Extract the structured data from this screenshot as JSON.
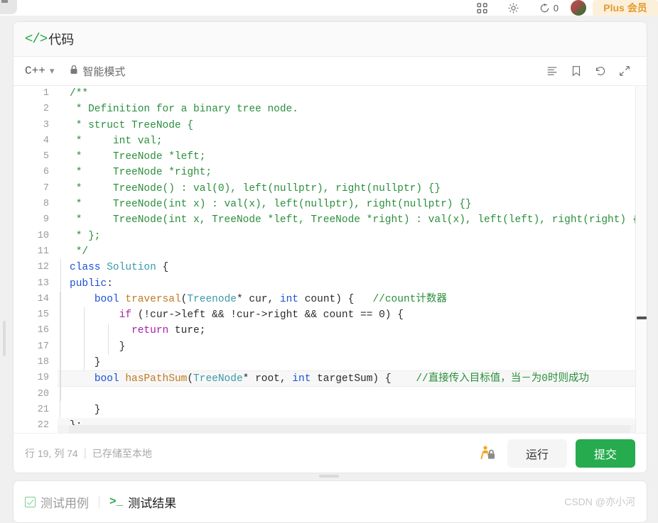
{
  "topbar": {
    "icons": [
      "apps-grid-icon",
      "gear-icon",
      "refresh-icon",
      "avatar"
    ],
    "notification_count": "0",
    "plus_label": "Plus 会员"
  },
  "code_panel": {
    "title": "代码",
    "title_icon": "code-brackets-icon",
    "toolbar": {
      "language": "C++",
      "language_chevron": "chevron-down-icon",
      "lock_icon": "lock-icon",
      "mode_label": "智能模式",
      "actions": [
        {
          "name": "format-code-icon",
          "label": "格式化"
        },
        {
          "name": "bookmark-icon",
          "label": "收藏"
        },
        {
          "name": "reset-code-icon",
          "label": "重置"
        },
        {
          "name": "fullscreen-icon",
          "label": "全屏"
        }
      ]
    },
    "editor": {
      "current_line": 19,
      "lines": [
        {
          "n": "1",
          "tokens": [
            {
              "t": "/**",
              "c": "cmt"
            }
          ]
        },
        {
          "n": "2",
          "tokens": [
            {
              "t": " * Definition for a binary tree node.",
              "c": "cmt"
            }
          ]
        },
        {
          "n": "3",
          "tokens": [
            {
              "t": " * struct TreeNode {",
              "c": "cmt"
            }
          ]
        },
        {
          "n": "4",
          "tokens": [
            {
              "t": " *     int val;",
              "c": "cmt"
            }
          ]
        },
        {
          "n": "5",
          "tokens": [
            {
              "t": " *     TreeNode *left;",
              "c": "cmt"
            }
          ]
        },
        {
          "n": "6",
          "tokens": [
            {
              "t": " *     TreeNode *right;",
              "c": "cmt"
            }
          ]
        },
        {
          "n": "7",
          "tokens": [
            {
              "t": " *     TreeNode() : val(0), left(nullptr), right(nullptr) {}",
              "c": "cmt"
            }
          ]
        },
        {
          "n": "8",
          "tokens": [
            {
              "t": " *     TreeNode(int x) : val(x), left(nullptr), right(nullptr) {}",
              "c": "cmt"
            }
          ]
        },
        {
          "n": "9",
          "tokens": [
            {
              "t": " *     TreeNode(int x, TreeNode *left, TreeNode *right) : val(x), left(left), right(right) {}",
              "c": "cmt"
            }
          ]
        },
        {
          "n": "10",
          "tokens": [
            {
              "t": " * };",
              "c": "cmt"
            }
          ]
        },
        {
          "n": "11",
          "tokens": [
            {
              "t": " */",
              "c": "cmt"
            }
          ]
        },
        {
          "n": "12",
          "tokens": [
            {
              "t": "class",
              "c": "kw"
            },
            {
              "t": " ",
              "c": "pln"
            },
            {
              "t": "Solution",
              "c": "typ"
            },
            {
              "t": " {",
              "c": "pln"
            }
          ]
        },
        {
          "n": "13",
          "tokens": [
            {
              "t": "public",
              "c": "kw"
            },
            {
              "t": ":",
              "c": "pln"
            }
          ]
        },
        {
          "n": "14",
          "tokens": [
            {
              "t": "    ",
              "c": "pln"
            },
            {
              "t": "bool",
              "c": "kw"
            },
            {
              "t": " ",
              "c": "pln"
            },
            {
              "t": "traversal",
              "c": "fn"
            },
            {
              "t": "(",
              "c": "pln"
            },
            {
              "t": "Treenode",
              "c": "typ"
            },
            {
              "t": "* cur, ",
              "c": "pln"
            },
            {
              "t": "int",
              "c": "kw"
            },
            {
              "t": " count) {   ",
              "c": "pln"
            },
            {
              "t": "//count计数器",
              "c": "cmt"
            }
          ]
        },
        {
          "n": "15",
          "tokens": [
            {
              "t": "        ",
              "c": "pln"
            },
            {
              "t": "if",
              "c": "kw2"
            },
            {
              "t": " (!cur->left && !cur->right && count == ",
              "c": "pln"
            },
            {
              "t": "0",
              "c": "num"
            },
            {
              "t": ") {",
              "c": "pln"
            }
          ]
        },
        {
          "n": "16",
          "tokens": [
            {
              "t": "          ",
              "c": "pln"
            },
            {
              "t": "return",
              "c": "kw2"
            },
            {
              "t": " ture;",
              "c": "pln"
            }
          ]
        },
        {
          "n": "17",
          "tokens": [
            {
              "t": "        }",
              "c": "pln"
            }
          ]
        },
        {
          "n": "18",
          "tokens": [
            {
              "t": "    }",
              "c": "pln"
            }
          ]
        },
        {
          "n": "19",
          "tokens": [
            {
              "t": "    ",
              "c": "pln"
            },
            {
              "t": "bool",
              "c": "kw"
            },
            {
              "t": " ",
              "c": "pln"
            },
            {
              "t": "hasPathSum",
              "c": "fn"
            },
            {
              "t": "(",
              "c": "pln"
            },
            {
              "t": "TreeNode",
              "c": "typ"
            },
            {
              "t": "* root, ",
              "c": "pln"
            },
            {
              "t": "int",
              "c": "kw"
            },
            {
              "t": " targetSum) {    ",
              "c": "pln"
            },
            {
              "t": "//直接传入目标值，当－为0时则成功",
              "c": "cmt"
            }
          ]
        },
        {
          "n": "20",
          "tokens": [
            {
              "t": "",
              "c": "pln"
            }
          ]
        },
        {
          "n": "21",
          "tokens": [
            {
              "t": "    }",
              "c": "pln"
            }
          ]
        },
        {
          "n": "22",
          "tokens": [
            {
              "t": "};",
              "c": "pln"
            }
          ]
        }
      ]
    },
    "status": {
      "position": "行 19, 列 74",
      "separator": "|",
      "saved": "已存储至本地",
      "privacy_icon": "person-lock-icon",
      "run_label": "运行",
      "submit_label": "提交"
    }
  },
  "result_panel": {
    "tabs": [
      {
        "label": "测试用例",
        "icon": "checkbox-icon",
        "active": false
      },
      {
        "label": "测试结果",
        "icon": "terminal-icon",
        "active": true
      }
    ],
    "watermark": "CSDN @亦小河"
  },
  "colors": {
    "accent_green": "#26ac4e",
    "comment": "#2a8f3c",
    "keyword": "#1b50d8",
    "keyword_control": "#a81fa8",
    "function": "#c07a20",
    "type": "#3a9ba8",
    "plus_orange": "#e09b2d"
  }
}
